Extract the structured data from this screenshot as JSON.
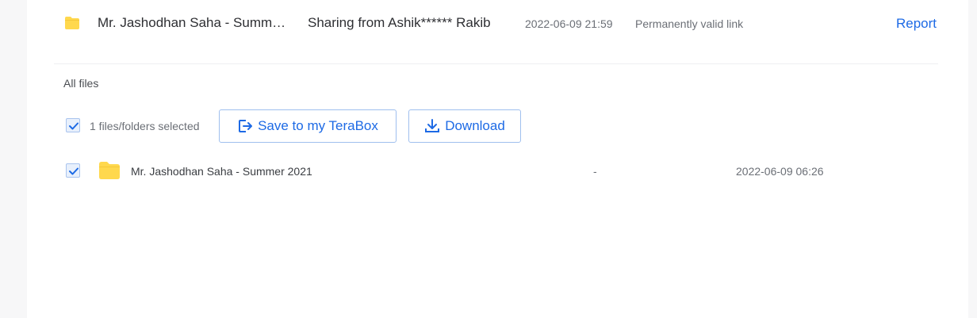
{
  "share": {
    "title": "Mr. Jashodhan Saha - Summ…",
    "from": "Sharing from Ashik****** Rakib",
    "time": "2022-06-09 21:59",
    "validity": "Permanently valid link",
    "report_label": "Report"
  },
  "section": {
    "label": "All files"
  },
  "toolbar": {
    "selected_count": "1 files/folders selected",
    "save_label": "Save to my TeraBox",
    "download_label": "Download"
  },
  "files": [
    {
      "name": "Mr. Jashodhan Saha - Summer 2021",
      "size": "-",
      "date": "2022-06-09 06:26",
      "checked": true,
      "icon": "folder-icon"
    }
  ],
  "colors": {
    "accent": "#1d6ae5",
    "folder": "#ffd84d"
  }
}
